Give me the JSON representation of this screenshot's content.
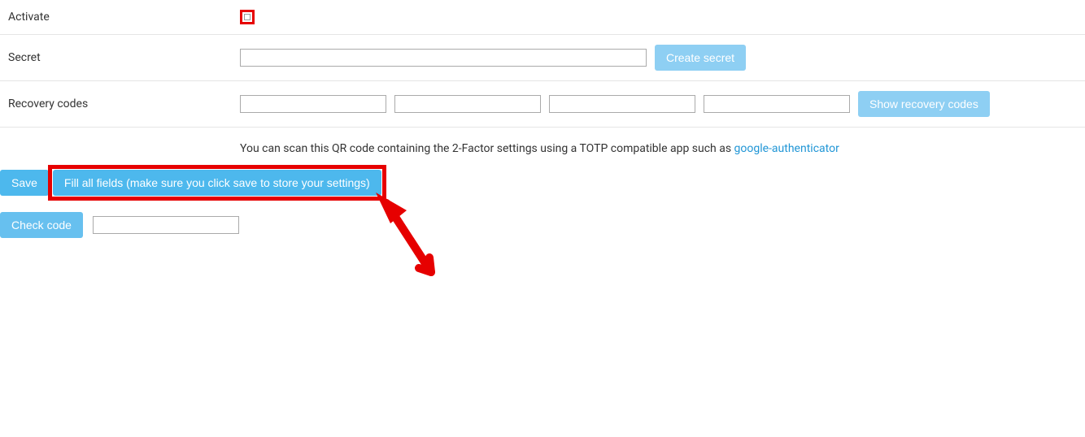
{
  "rows": {
    "activate": {
      "label": "Activate"
    },
    "secret": {
      "label": "Secret",
      "value": "",
      "button": "Create secret"
    },
    "recovery": {
      "label": "Recovery codes",
      "values": [
        "",
        "",
        "",
        ""
      ],
      "button": "Show recovery codes"
    }
  },
  "info": {
    "text": "You can scan this QR code containing the 2-Factor settings using a TOTP compatible app such as ",
    "link_text": "google-authenticator"
  },
  "actions": {
    "save": "Save",
    "fill": "Fill all fields (make sure you click save to store your settings)",
    "check": "Check code",
    "check_value": ""
  }
}
